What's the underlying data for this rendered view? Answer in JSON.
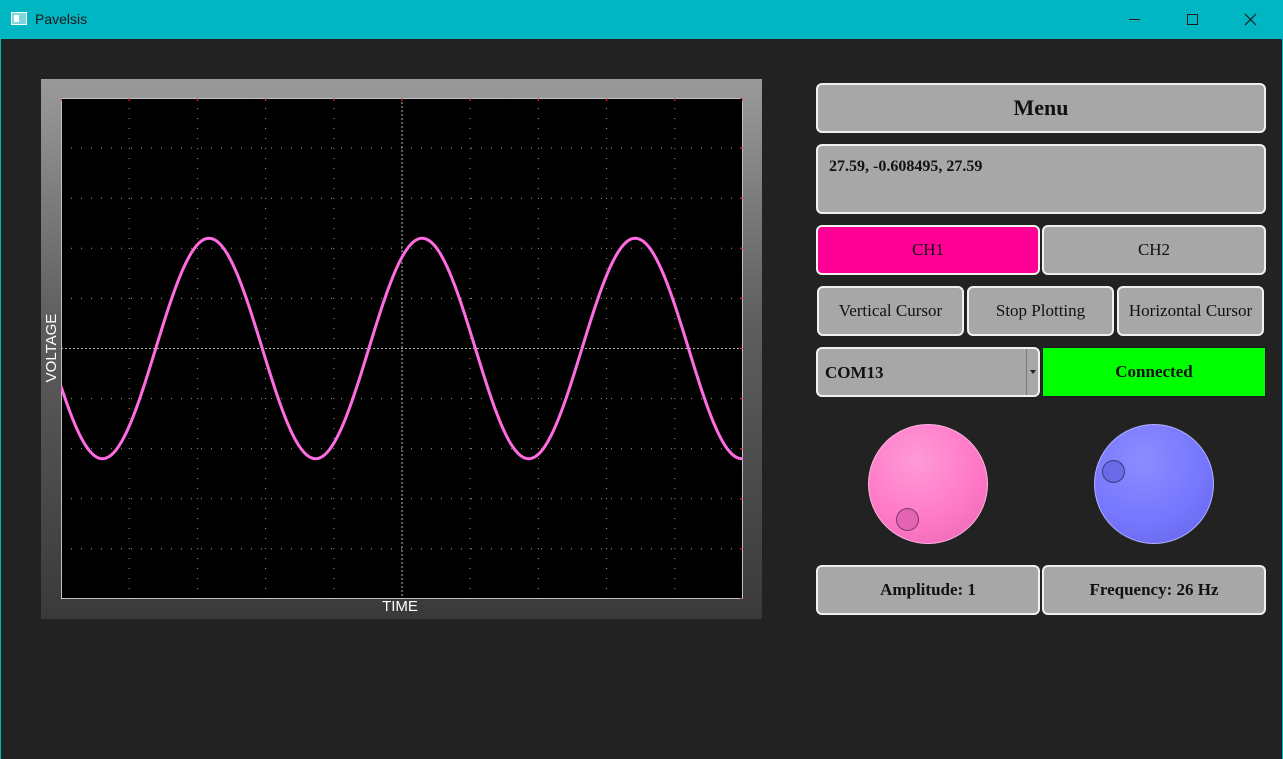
{
  "window": {
    "title": "Pavelsis"
  },
  "plot": {
    "xlabel": "TIME",
    "ylabel": "VOLTAGE",
    "trace_color": "#ff6be0",
    "grid_color": "#cfcfcf",
    "background": "#000000"
  },
  "chart_data": {
    "type": "line",
    "xlabel": "TIME",
    "ylabel": "VOLTAGE",
    "grid": true,
    "divisions": {
      "x": 10,
      "y": 10
    },
    "series": [
      {
        "waveform": "sine",
        "amplitude_div": 2.2,
        "offset_div": 0.0,
        "cycles_shown": 3.2,
        "phase_at_left_deg": 200
      }
    ]
  },
  "panel": {
    "menu_label": "Menu",
    "readout": "27.59, -0.608495, 27.59",
    "ch1_label": "CH1",
    "ch2_label": "CH2",
    "vertical_cursor_label": "Vertical Cursor",
    "stop_plotting_label": "Stop Plotting",
    "horizontal_cursor_label": "Horizontal Cursor",
    "port_value": "COM13",
    "status_label": "Connected",
    "amplitude_label": "Amplitude: 1",
    "frequency_label": "Frequency: 26 Hz"
  },
  "colors": {
    "titlebar": "#00b6c3",
    "ch1_active": "#ff0096",
    "connected": "#00ff00",
    "amplitude_knob": "#ff79c6",
    "frequency_knob": "#7777ff"
  },
  "icons": {
    "app": "app-window-icon",
    "minimize": "minimize-icon",
    "maximize": "maximize-icon",
    "close": "close-icon",
    "dropdown": "chevron-down-icon"
  }
}
